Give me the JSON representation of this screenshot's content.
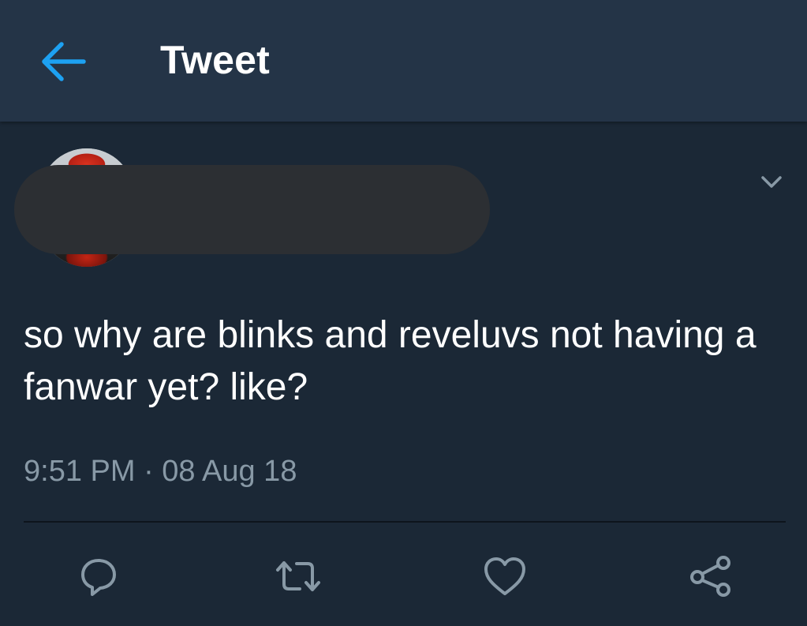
{
  "header": {
    "title": "Tweet",
    "back_icon": "arrow-left-icon",
    "accent_color": "#1da1f2"
  },
  "tweet": {
    "text": "so why are blinks and reveluvs not having a fanwar yet? like?",
    "timestamp": "9:51 PM · 08 Aug 18",
    "menu_icon": "chevron-down-icon"
  },
  "actions": [
    {
      "name": "reply",
      "icon": "reply-icon"
    },
    {
      "name": "retweet",
      "icon": "retweet-icon"
    },
    {
      "name": "like",
      "icon": "heart-icon"
    },
    {
      "name": "share",
      "icon": "share-icon"
    }
  ],
  "colors": {
    "background": "#1b2836",
    "header": "#243447",
    "secondary_text": "#8899a6"
  }
}
